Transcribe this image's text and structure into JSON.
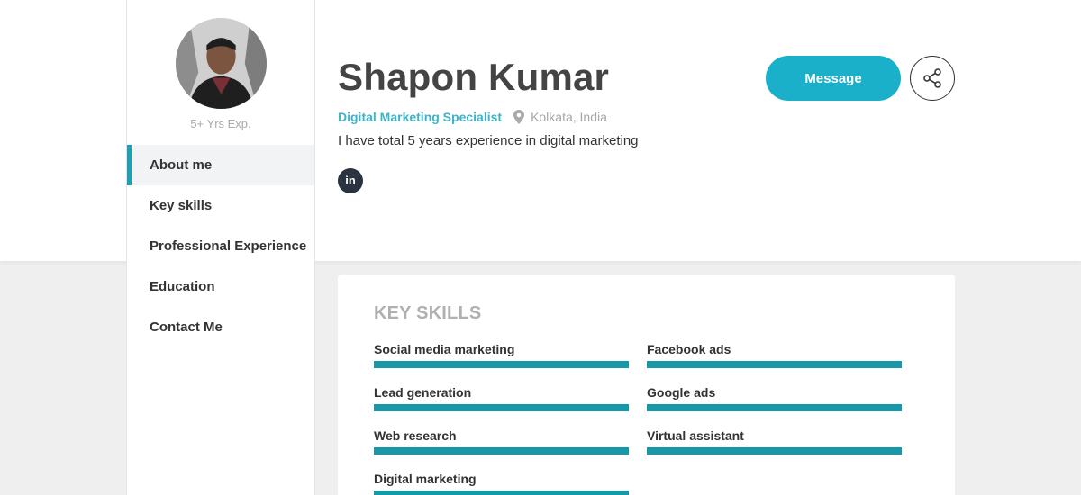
{
  "profile": {
    "name": "Shapon Kumar",
    "role": "Digital Marketing Specialist",
    "location": "Kolkata, India",
    "bio": "I have total 5 years experience in digital marketing",
    "experience": "5+ Yrs Exp.",
    "linkedin_label": "in"
  },
  "actions": {
    "message_label": "Message"
  },
  "sidebar": {
    "items": [
      {
        "label": "About me"
      },
      {
        "label": "Key skills"
      },
      {
        "label": "Professional Experience"
      },
      {
        "label": "Education"
      },
      {
        "label": "Contact Me"
      }
    ]
  },
  "skills": {
    "title": "KEY SKILLS",
    "items": [
      {
        "label": "Social media marketing",
        "level": 1.0
      },
      {
        "label": "Facebook ads",
        "level": 1.0
      },
      {
        "label": "Lead generation",
        "level": 1.0
      },
      {
        "label": "Google ads",
        "level": 1.0
      },
      {
        "label": "Web research",
        "level": 1.0
      },
      {
        "label": "Virtual assistant",
        "level": 1.0
      },
      {
        "label": "Digital marketing",
        "level": 1.0
      }
    ]
  },
  "colors": {
    "accent": "#1ab0c9",
    "bar": "#1798a8",
    "role": "#40b3c6"
  },
  "icons": {
    "share": "share-icon",
    "location": "map-pin-icon",
    "linkedin": "linkedin-icon"
  }
}
